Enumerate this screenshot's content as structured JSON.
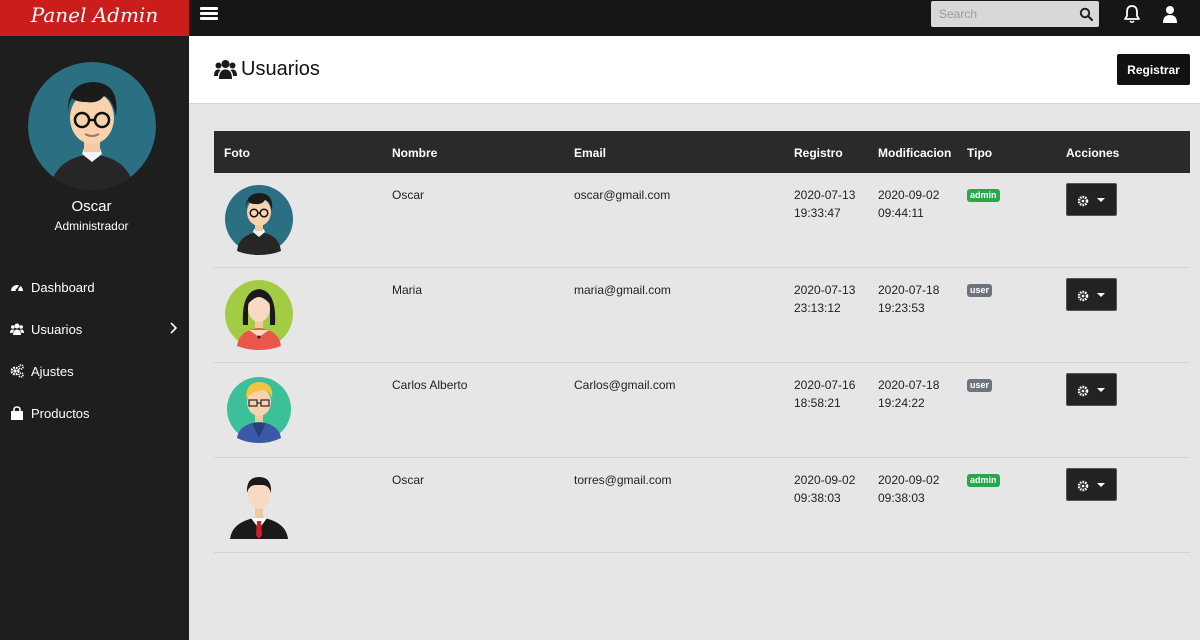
{
  "brand": "Panel Admin",
  "search": {
    "placeholder": "Search"
  },
  "profile": {
    "name": "Oscar",
    "role": "Administrador"
  },
  "nav": [
    {
      "label": "Dashboard",
      "icon": "dashboard-icon"
    },
    {
      "label": "Usuarios",
      "icon": "users-icon",
      "has_submenu": true
    },
    {
      "label": "Ajustes",
      "icon": "cogs-icon"
    },
    {
      "label": "Productos",
      "icon": "shopping-bag-icon"
    }
  ],
  "header": {
    "title": "Usuarios",
    "register_label": "Registrar"
  },
  "table": {
    "columns": [
      "Foto",
      "Nombre",
      "Email",
      "Registro",
      "Modificacion",
      "Tipo",
      "Acciones"
    ],
    "rows": [
      {
        "nombre": "Oscar",
        "email": "oscar@gmail.com",
        "registro_fecha": "2020-07-13",
        "registro_hora": "19:33:47",
        "mod_fecha": "2020-09-02",
        "mod_hora": "09:44:11",
        "tipo": "admin"
      },
      {
        "nombre": "Maria",
        "email": "maria@gmail.com",
        "registro_fecha": "2020-07-13",
        "registro_hora": "23:13:12",
        "mod_fecha": "2020-07-18",
        "mod_hora": "19:23:53",
        "tipo": "user"
      },
      {
        "nombre": "Carlos Alberto",
        "email": "Carlos@gmail.com",
        "registro_fecha": "2020-07-16",
        "registro_hora": "18:58:21",
        "mod_fecha": "2020-07-18",
        "mod_hora": "19:24:22",
        "tipo": "user"
      },
      {
        "nombre": "Oscar",
        "email": "torres@gmail.com",
        "registro_fecha": "2020-09-02",
        "registro_hora": "09:38:03",
        "mod_fecha": "2020-09-02",
        "mod_hora": "09:38:03",
        "tipo": "admin"
      }
    ]
  },
  "colors": {
    "brand_red": "#cc1d1d",
    "topbar": "#161616",
    "sidebar": "#1e1e1e",
    "admin_badge": "#27a84a",
    "user_badge": "#6c757d"
  }
}
